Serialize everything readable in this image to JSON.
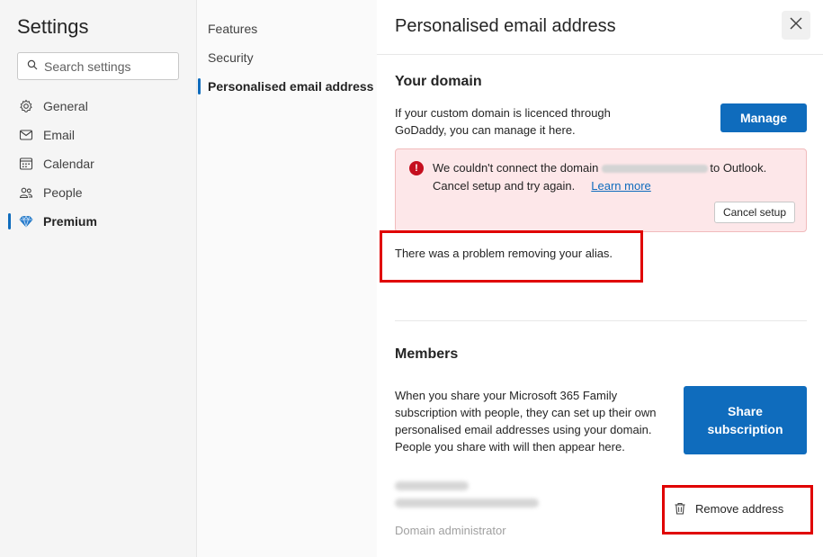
{
  "sidebar": {
    "title": "Settings",
    "search_placeholder": "Search settings",
    "items": [
      {
        "label": "General",
        "icon": "gear-icon"
      },
      {
        "label": "Email",
        "icon": "mail-icon"
      },
      {
        "label": "Calendar",
        "icon": "calendar-icon"
      },
      {
        "label": "People",
        "icon": "people-icon"
      },
      {
        "label": "Premium",
        "icon": "diamond-icon",
        "active": true
      }
    ]
  },
  "subnav": {
    "items": [
      {
        "label": "Features"
      },
      {
        "label": "Security"
      },
      {
        "label": "Personalised email address",
        "active": true
      }
    ]
  },
  "panel": {
    "title": "Personalised email address",
    "domain": {
      "heading": "Your domain",
      "description": "If your custom domain is licenced through GoDaddy, you can manage it here.",
      "manage_label": "Manage",
      "error": {
        "text_before": "We couldn't connect the domain",
        "text_after": "to Outlook. Cancel setup and try again.",
        "learn_more": "Learn more",
        "cancel_label": "Cancel setup"
      },
      "problem_text": "There was a problem removing your alias."
    },
    "members": {
      "heading": "Members",
      "description": "When you share your Microsoft 365 Family subscription with people, they can set up their own personalised email addresses using your domain. People you share with will then appear here.",
      "share_label": "Share subscription",
      "member_role": "Domain administrator",
      "remove_label": "Remove address"
    }
  },
  "colors": {
    "accent": "#0f6cbd",
    "error_bg": "#fde7e9",
    "error_icon": "#c50f1f",
    "highlight": "#e00000"
  }
}
